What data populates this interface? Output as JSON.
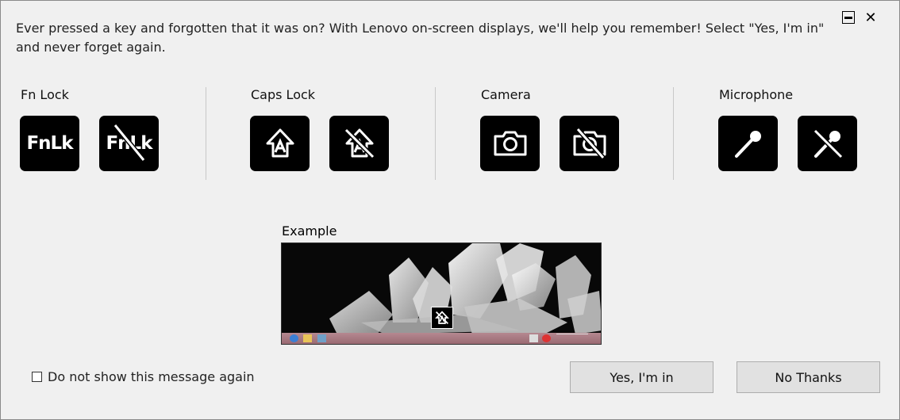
{
  "message": "Ever pressed a key and forgotten that it was on? With Lenovo on-screen displays, we'll help you remember! Select \"Yes, I'm in\" and never forget again.",
  "window_controls": {
    "minimize_icon": "minimize-icon",
    "close_symbol": "✕"
  },
  "groups": [
    {
      "title": "Fn Lock",
      "on_text": "FnLk",
      "off_text": "FnLk"
    },
    {
      "title": "Caps Lock",
      "on_icon": "caps-lock-on-icon",
      "off_icon": "caps-lock-off-icon"
    },
    {
      "title": "Camera",
      "on_icon": "camera-on-icon",
      "off_icon": "camera-off-icon"
    },
    {
      "title": "Microphone",
      "on_icon": "microphone-on-icon",
      "off_icon": "microphone-off-icon"
    }
  ],
  "example": {
    "label": "Example",
    "osd_icon": "caps-lock-off-icon"
  },
  "checkbox": {
    "label": "Do not show this message again",
    "checked": false
  },
  "buttons": {
    "yes": "Yes, I'm in",
    "no": "No Thanks"
  },
  "colors": {
    "tile": "#000000",
    "background": "#f0f0f0",
    "button": "#e1e1e1"
  }
}
